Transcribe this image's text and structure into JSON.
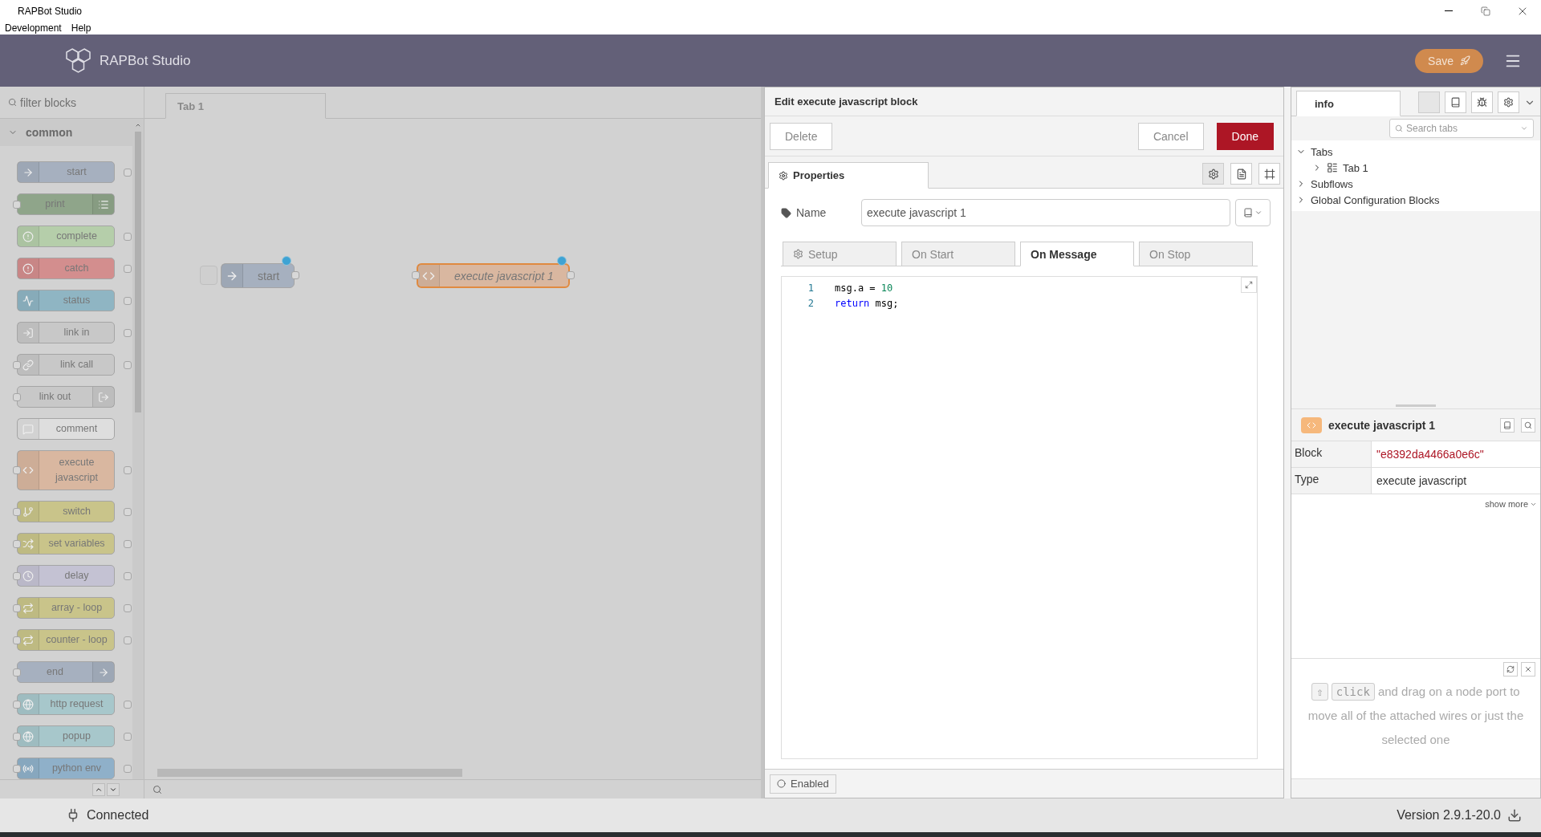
{
  "window": {
    "title": "RAPBot Studio",
    "menu": [
      "Development",
      "Help"
    ]
  },
  "header": {
    "brand": "RAPBot Studio",
    "save": "Save"
  },
  "palette": {
    "filter_placeholder": "filter blocks",
    "category": {
      "label": "common",
      "expanded": true
    },
    "blocks": [
      {
        "label": "start",
        "color": "#a6b0bf",
        "input": false,
        "output": true,
        "icon_right": false
      },
      {
        "label": "print",
        "color": "#8fa58a",
        "input": true,
        "output": false,
        "icon_right": true
      },
      {
        "label": "complete",
        "color": "#b5ceaa",
        "input": false,
        "output": true,
        "icon_right": false
      },
      {
        "label": "catch",
        "color": "#d38e8e",
        "input": false,
        "output": true,
        "icon_right": false
      },
      {
        "label": "status",
        "color": "#8fb5c3",
        "input": false,
        "output": true,
        "icon_right": false
      },
      {
        "label": "link in",
        "color": "#c8c8c8",
        "input": false,
        "output": true,
        "icon_right": false
      },
      {
        "label": "link call",
        "color": "#c8c8c8",
        "input": true,
        "output": true,
        "icon_right": false
      },
      {
        "label": "link out",
        "color": "#c8c8c8",
        "input": true,
        "output": false,
        "icon_right": true
      },
      {
        "label": "comment",
        "color": "#dedede",
        "input": false,
        "output": false,
        "icon_right": false
      },
      {
        "label": "execute javascript",
        "color": "#d9b7a0",
        "input": true,
        "output": true,
        "icon_right": false
      },
      {
        "label": "switch",
        "color": "#c9c48a",
        "input": true,
        "output": true,
        "icon_right": false
      },
      {
        "label": "set variables",
        "color": "#c9c48a",
        "input": true,
        "output": true,
        "icon_right": false
      },
      {
        "label": "delay",
        "color": "#c4c2d3",
        "input": true,
        "output": true,
        "icon_right": false
      },
      {
        "label": "array - loop",
        "color": "#c9c48a",
        "input": true,
        "output": true,
        "icon_right": false
      },
      {
        "label": "counter - loop",
        "color": "#c9c48a",
        "input": true,
        "output": true,
        "icon_right": false
      },
      {
        "label": "end",
        "color": "#a6b0bf",
        "input": true,
        "output": false,
        "icon_right": true
      },
      {
        "label": "http request",
        "color": "#a7c7cb",
        "input": true,
        "output": true,
        "icon_right": false
      },
      {
        "label": "popup",
        "color": "#a7c7cb",
        "input": true,
        "output": true,
        "icon_right": false
      },
      {
        "label": "python env",
        "color": "#8fb0c9",
        "input": true,
        "output": true,
        "icon_right": false
      }
    ]
  },
  "workspace": {
    "tabs": [
      {
        "label": "Tab 1",
        "selected": true
      }
    ],
    "nodes": [
      {
        "label": "start",
        "color": "#a6b0bf",
        "input": false,
        "output": true,
        "changed": true,
        "selected": false,
        "italic": false
      },
      {
        "label": "execute javascript 1",
        "color": "#d9b7a0",
        "input": true,
        "output": true,
        "changed": true,
        "selected": true,
        "italic": true
      }
    ]
  },
  "editor": {
    "title": "Edit execute javascript block",
    "buttons": {
      "delete": "Delete",
      "cancel": "Cancel",
      "done": "Done"
    },
    "tab": "Properties",
    "name_label": "Name",
    "name_value": "execute javascript 1",
    "subtabs": [
      {
        "label": "Setup",
        "selected": false
      },
      {
        "label": "On Start",
        "selected": false
      },
      {
        "label": "On Message",
        "selected": true
      },
      {
        "label": "On Stop",
        "selected": false
      }
    ],
    "code": [
      {
        "number": "1",
        "segments": [
          {
            "kind": "plain",
            "text": "msg.a = "
          },
          {
            "kind": "number",
            "text": "10"
          }
        ]
      },
      {
        "number": "2",
        "segments": [
          {
            "kind": "keyword",
            "text": "return"
          },
          {
            "kind": "plain",
            "text": " msg;"
          }
        ]
      }
    ],
    "enabled_label": "Enabled"
  },
  "sidebar": {
    "tab": "info",
    "search_placeholder": "Search tabs",
    "tree": [
      {
        "label": "Tabs",
        "expanded": true,
        "children": [
          {
            "label": "Tab 1",
            "expanded": false
          }
        ]
      },
      {
        "label": "Subflows",
        "expanded": false
      },
      {
        "label": "Global Configuration Blocks",
        "expanded": false
      }
    ],
    "node": {
      "title": "execute javascript 1",
      "rows": [
        {
          "key": "Block",
          "value": "\"e8392da4466a0e6c\"",
          "kind": "id"
        },
        {
          "key": "Type",
          "value": "execute javascript",
          "kind": "plain"
        }
      ],
      "show_more": "show more"
    },
    "tip": {
      "keys": [
        "⇧",
        "click"
      ],
      "text": "and drag on a node port to move all of the attached wires or just the selected one"
    }
  },
  "status_bar": {
    "connection": "Connected",
    "version": "Version 2.9.1-20.0"
  }
}
